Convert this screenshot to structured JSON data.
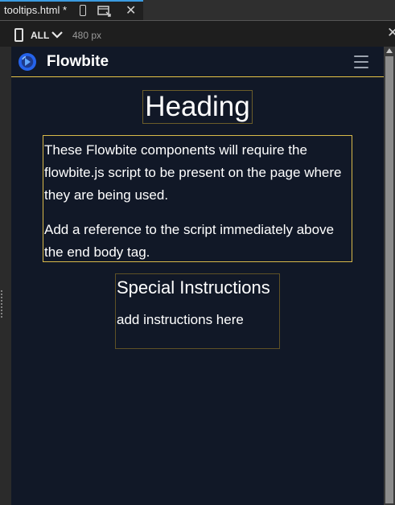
{
  "editor": {
    "tab_title": "tooltips.html *",
    "device_label": "ALL",
    "width_readout": "480 px"
  },
  "page": {
    "brand": "Flowbite",
    "heading": "Heading",
    "paragraphs": [
      "These Flowbite components will require the flowbite.js script to be present on the page where they are being used.",
      "Add a reference to the script immediately above the end body tag."
    ],
    "special_title": "Special Instructions",
    "special_body": "add instructions here"
  },
  "colors": {
    "page_background": "#111827",
    "accent_border": "#d8b94a",
    "brand_blue": "#2563eb",
    "editor_tab_accent": "#3b9be0"
  },
  "icons": {
    "tab_mobile": "mobile-icon",
    "tab_preview": "preview-icon",
    "tab_close": "close-icon",
    "device": "device-icon",
    "dropdown": "chevron-down-icon",
    "brand": "flowbite-logo-icon",
    "menu": "hamburger-menu-icon"
  }
}
